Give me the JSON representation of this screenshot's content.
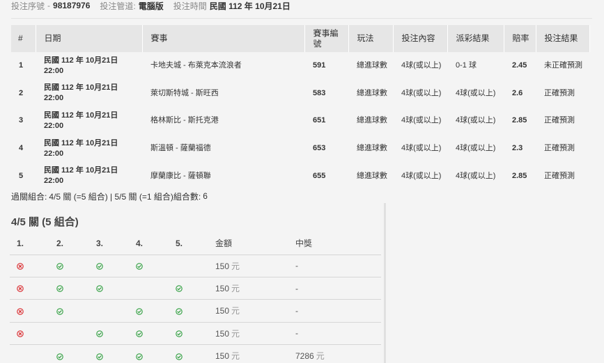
{
  "info": {
    "serial_label": "投注序號",
    "serial_dash": "-",
    "serial": "98187976",
    "channel_label": "投注管道:",
    "channel": "電腦版",
    "time_label": "投注時間",
    "time": "民國 112 年 10月21日"
  },
  "table": {
    "headers": [
      "#",
      "日期",
      "賽事",
      "賽事編號",
      "玩法",
      "投注內容",
      "派彩結果",
      "賠率",
      "投注結果"
    ],
    "rows": [
      {
        "no": "1",
        "date": "民國 112 年 10月21日",
        "time": "22:00",
        "match": "卡地夫城 - 布萊克本流浪者",
        "event_id": "591",
        "play": "總進球數",
        "bet": "4球(或以上)",
        "payout": "0-1 球",
        "odds": "2.45",
        "result": "未正確預測"
      },
      {
        "no": "2",
        "date": "民國 112 年 10月21日",
        "time": "22:00",
        "match": "萊切斯特城 - 斯旺西",
        "event_id": "583",
        "play": "總進球數",
        "bet": "4球(或以上)",
        "payout": "4球(或以上)",
        "odds": "2.6",
        "result": "正確預測"
      },
      {
        "no": "3",
        "date": "民國 112 年 10月21日",
        "time": "22:00",
        "match": "格林斯比 - 斯托克港",
        "event_id": "651",
        "play": "總進球數",
        "bet": "4球(或以上)",
        "payout": "4球(或以上)",
        "odds": "2.85",
        "result": "正確預測"
      },
      {
        "no": "4",
        "date": "民國 112 年 10月21日",
        "time": "22:00",
        "match": "斯溫頓 - 薩蘭福德",
        "event_id": "653",
        "play": "總進球數",
        "bet": "4球(或以上)",
        "payout": "4球(或以上)",
        "odds": "2.3",
        "result": "正確預測"
      },
      {
        "no": "5",
        "date": "民國 112 年 10月21日",
        "time": "22:00",
        "match": "摩蘭康比 - 薩頓聯",
        "event_id": "655",
        "play": "總進球數",
        "bet": "4球(或以上)",
        "payout": "4球(或以上)",
        "odds": "2.85",
        "result": "正確預測"
      }
    ]
  },
  "combo_summary": {
    "label": "過關組合:",
    "text": "4/5 關 (=5 組合) | 5/5 關 (=1 組合)組合數:",
    "count": "6"
  },
  "combo": {
    "title": "4/5 關 (5 組合)",
    "headers": [
      "1.",
      "2.",
      "3.",
      "4.",
      "5.",
      "金額",
      "中獎"
    ],
    "rows": [
      {
        "legs": [
          "lose",
          "win",
          "win",
          "win",
          ""
        ],
        "amount": "150",
        "unit": "元",
        "prize": "-",
        "prize_unit": ""
      },
      {
        "legs": [
          "lose",
          "win",
          "win",
          "",
          "win"
        ],
        "amount": "150",
        "unit": "元",
        "prize": "-",
        "prize_unit": ""
      },
      {
        "legs": [
          "lose",
          "win",
          "",
          "win",
          "win"
        ],
        "amount": "150",
        "unit": "元",
        "prize": "-",
        "prize_unit": ""
      },
      {
        "legs": [
          "lose",
          "",
          "win",
          "win",
          "win"
        ],
        "amount": "150",
        "unit": "元",
        "prize": "-",
        "prize_unit": ""
      },
      {
        "legs": [
          "",
          "win",
          "win",
          "win",
          "win"
        ],
        "amount": "150",
        "unit": "元",
        "prize": "7286",
        "prize_unit": "元"
      }
    ]
  },
  "colors": {
    "win": "#2e9e3e",
    "lose": "#d9262a",
    "header_bg": "#e6e6e6",
    "page_bg": "#f4f4f4"
  },
  "icons": {
    "win": "check-circle-icon",
    "lose": "cross-circle-icon"
  }
}
